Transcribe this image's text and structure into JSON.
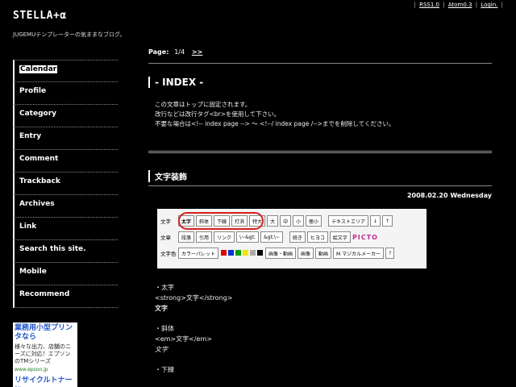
{
  "toplinks": [
    "RSS1.0",
    "Atom0.3",
    "Login."
  ],
  "site": {
    "title": "STELLA+α",
    "tagline": "JUGEMUテンプレーターの気ままなブログ。"
  },
  "sidebar": {
    "items": [
      "Calendar",
      "Profile",
      "Category",
      "Entry",
      "Comment",
      "Trackback",
      "Archives",
      "Link",
      "Search this site.",
      "Mobile",
      "Recommend"
    ]
  },
  "ad": {
    "title": "業務用小型プリンタなら",
    "body": "様々な出力、店舗のニーズに対応！エプソンのTMシリーズ",
    "url": "www.epson.jp",
    "more": "リサイクルトナー 好"
  },
  "pager": {
    "label": "Page:",
    "value": "1/4",
    "next": ">>"
  },
  "index": {
    "title": "- INDEX -",
    "lines": [
      "この文章はトップに固定されます。",
      "改行などは改行タグ<br>を使用して下さい。",
      "不要な場合は<!-- index page --> 〜 <!--/ index page /-->までを削除してください。"
    ]
  },
  "entry": {
    "title": "文字装飾",
    "date": "2008.02.20 Wednesday"
  },
  "toolbar": {
    "row1_label": "文字",
    "row1": [
      "太字",
      "斜体",
      "下線",
      "打消",
      "特大",
      "大",
      "中",
      "小",
      "極小",
      "テキストエリア",
      "↓",
      "↑"
    ],
    "row2_label": "文章",
    "row2": [
      "段落",
      "引用",
      "リンク",
      "\\~&gt;",
      "&gt;\\~",
      "続き",
      "ヒヨコ",
      "絵文字",
      "PICTO"
    ],
    "row3_label": "文字色",
    "row3_palette": "カラーパレット",
    "row3_colors": [
      "#e00000",
      "#0033cc",
      "#00a000",
      "#f5e400",
      "#aaaaaa",
      "#000000"
    ],
    "row3": [
      "画像・動画",
      "画像",
      "動画",
      "M マジカルメーカー",
      "?"
    ]
  },
  "tags": {
    "bold_title": "・太字",
    "bold_code": "<strong>文字</strong>",
    "bold_sample": "文字",
    "em_title": "・斜体",
    "em_code": "<em>文字</em>",
    "em_sample": "文字",
    "u_title": "・下線"
  }
}
